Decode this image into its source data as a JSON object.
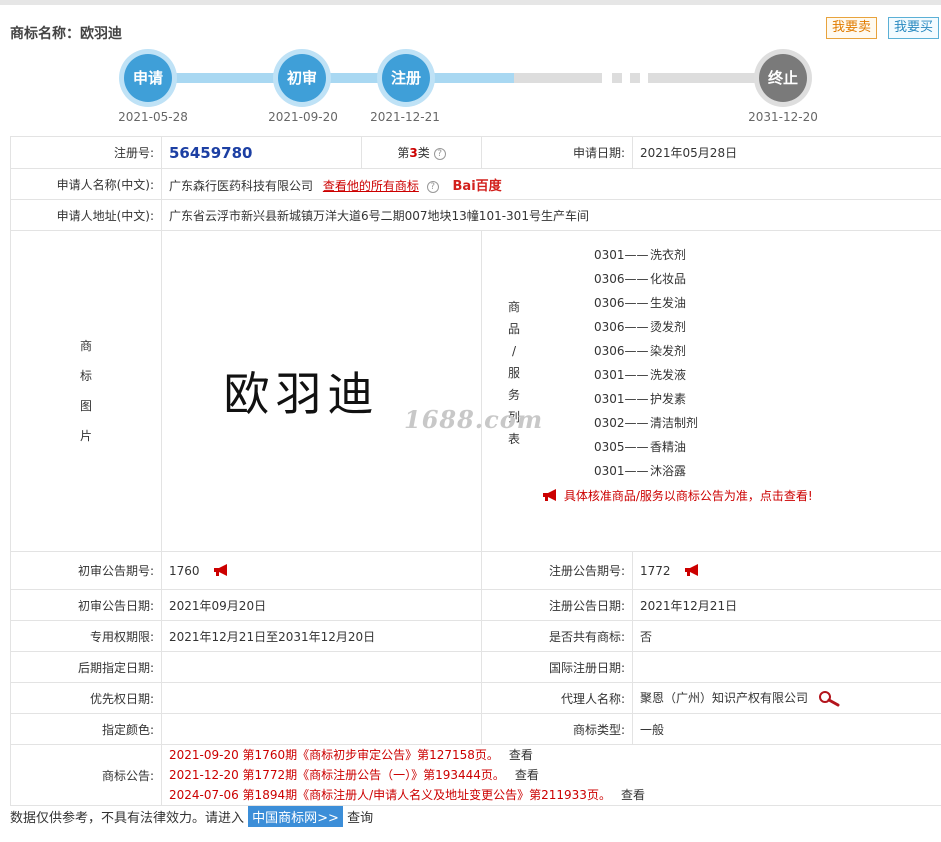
{
  "header": {
    "title": "商标名称：欧羽迪",
    "sell_label": "我要卖",
    "buy_label": "我要买"
  },
  "status": {
    "steps": [
      {
        "label": "申请",
        "date": "2021-05-28",
        "state": "done"
      },
      {
        "label": "初审",
        "date": "2021-09-20",
        "state": "done"
      },
      {
        "label": "注册",
        "date": "2021-12-21",
        "state": "done"
      },
      {
        "label": "终止",
        "date": "2031-12-20",
        "state": "future"
      }
    ],
    "colors": {
      "done": "#3f9fd8",
      "future": "#7a7a7a"
    }
  },
  "info": {
    "reg_no_label": "注册号:",
    "reg_no": "56459780",
    "class_prefix": "第",
    "class_num": "3",
    "class_suffix": "类",
    "apply_date_label": "申请日期:",
    "apply_date": "2021年05月28日",
    "applicant_label": "申请人名称(中文):",
    "applicant": "广东森行医药科技有限公司",
    "applicant_link": "查看他的所有商标",
    "baidu_logo": "Bai百度",
    "address_label": "申请人地址(中文):",
    "address": "广东省云浮市新兴县新城镇万洋大道6号二期007地块13幢101-301号生产车间",
    "image_label_chars": [
      "商",
      "标",
      "图",
      "片"
    ],
    "mark_text": "欧羽迪",
    "watermark": "1688.com",
    "goods_label_chars": [
      "商",
      "品",
      "/",
      "服",
      "务",
      "列",
      "表"
    ],
    "goods": [
      {
        "code": "0301——",
        "name": "洗衣剂"
      },
      {
        "code": "0306——",
        "name": "化妆品"
      },
      {
        "code": "0306——",
        "name": "生发油"
      },
      {
        "code": "0306——",
        "name": "烫发剂"
      },
      {
        "code": "0306——",
        "name": "染发剂"
      },
      {
        "code": "0301——",
        "name": "洗发液"
      },
      {
        "code": "0301——",
        "name": "护发素"
      },
      {
        "code": "0302——",
        "name": "清洁制剂"
      },
      {
        "code": "0305——",
        "name": "香精油"
      },
      {
        "code": "0301——",
        "name": "沐浴露"
      }
    ],
    "goods_notice": "具体核准商品/服务以商标公告为准，点击查看!",
    "prelim_no_label": "初审公告期号:",
    "prelim_no": "1760",
    "reg_ann_no_label": "注册公告期号:",
    "reg_ann_no": "1772",
    "prelim_date_label": "初审公告日期:",
    "prelim_date": "2021年09月20日",
    "reg_ann_date_label": "注册公告日期:",
    "reg_ann_date": "2021年12月21日",
    "exclusive_label": "专用权期限:",
    "exclusive": "2021年12月21日至2031年12月20日",
    "shared_label": "是否共有商标:",
    "shared": "否",
    "later_label": "后期指定日期:",
    "later": "",
    "intl_label": "国际注册日期:",
    "intl": "",
    "priority_label": "优先权日期:",
    "priority": "",
    "agent_label": "代理人名称:",
    "agent": "聚恩（广州）知识产权有限公司",
    "color_label": "指定颜色:",
    "color": "",
    "type_label": "商标类型:",
    "type": "一般",
    "announce_label": "商标公告:",
    "announcements": [
      {
        "text": "2021-09-20 第1760期《商标初步审定公告》第127158页。",
        "see": "查看"
      },
      {
        "text": "2021-12-20 第1772期《商标注册公告（一）》第193444页。",
        "see": "查看"
      },
      {
        "text": "2024-07-06 第1894期《商标注册人/申请人名义及地址变更公告》第211933页。",
        "see": "查看"
      }
    ]
  },
  "footer": {
    "text": "数据仅供参考，不具有法律效力。请进入",
    "link": "中国商标网>>",
    "suffix": "查询"
  }
}
